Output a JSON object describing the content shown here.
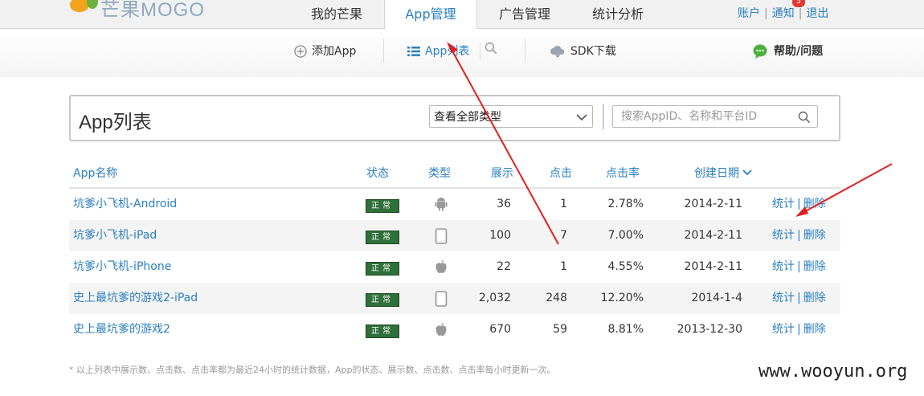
{
  "brand": {
    "logo_text": "芒果MOGO"
  },
  "nav": {
    "tabs": [
      "我的芒果",
      "App管理",
      "广告管理",
      "统计分析"
    ],
    "active": 1
  },
  "user": {
    "account": "账户",
    "notify": "通知",
    "notify_count": "5",
    "logout": "退出"
  },
  "toolbar": {
    "add_app": "添加App",
    "app_list": "App列表",
    "sdk_download": "SDK下载",
    "help": "帮助/问题"
  },
  "panel": {
    "title": "App列表",
    "type_filter": "查看全部类型",
    "search_placeholder": "搜索AppID、名称和平台ID"
  },
  "table": {
    "headers": {
      "name": "App名称",
      "status": "状态",
      "type": "类型",
      "impressions": "展示",
      "clicks": "点击",
      "ctr": "点击率",
      "created": "创建日期"
    },
    "rows": [
      {
        "name": "坑爹小飞机-Android",
        "status": "正常",
        "type": "android-icon",
        "impressions": "36",
        "clicks": "1",
        "ctr": "2.78%",
        "created": "2014-2-11"
      },
      {
        "name": "坑爹小飞机-iPad",
        "status": "正常",
        "type": "tablet-icon",
        "impressions": "100",
        "clicks": "7",
        "ctr": "7.00%",
        "created": "2014-2-11"
      },
      {
        "name": "坑爹小飞机-iPhone",
        "status": "正常",
        "type": "apple-icon",
        "impressions": "22",
        "clicks": "1",
        "ctr": "4.55%",
        "created": "2014-2-11"
      },
      {
        "name": "史上最坑爹的游戏2-iPad",
        "status": "正常",
        "type": "tablet-icon",
        "impressions": "2,032",
        "clicks": "248",
        "ctr": "12.20%",
        "created": "2014-1-4"
      },
      {
        "name": "史上最坑爹的游戏2",
        "status": "正常",
        "type": "apple-icon",
        "impressions": "670",
        "clicks": "59",
        "ctr": "8.81%",
        "created": "2013-12-30"
      }
    ],
    "actions": {
      "stats": "统计",
      "delete": "删除",
      "sep": "|"
    }
  },
  "footnote": "* 以上列表中展示数、点击数、点击率都为最近24小时的统计数据，App的状态、展示数、点击数、点击率每小时更新一次。",
  "watermark": "www.wooyun.org",
  "colors": {
    "link": "#2a7fc0",
    "status_bg": "#2f6f3a",
    "badge": "#e03a2f",
    "annotation_arrow": "#e02020"
  }
}
